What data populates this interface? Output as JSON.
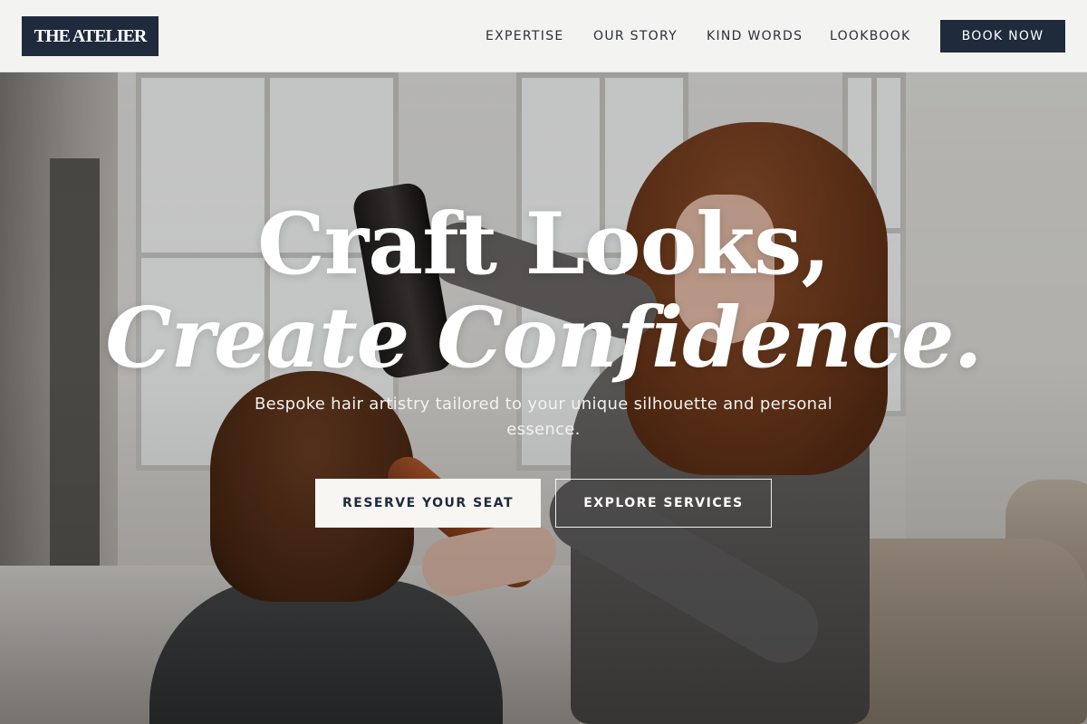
{
  "brand": {
    "logo_text": "THE ATELIER"
  },
  "nav": {
    "items": [
      {
        "label": "EXPERTISE"
      },
      {
        "label": "OUR STORY"
      },
      {
        "label": "KIND WORDS"
      },
      {
        "label": "LOOKBOOK"
      }
    ],
    "cta_label": "BOOK NOW"
  },
  "hero": {
    "headline_line1": "Craft Looks,",
    "headline_line2": "Create Confidence.",
    "subtitle": "Bespoke hair artistry tailored to your unique silhouette and personal essence.",
    "primary_button": "RESERVE YOUR SEAT",
    "secondary_button": "EXPLORE SERVICES"
  },
  "colors": {
    "brand_navy": "#1f2a3c",
    "header_bg": "#f6f6f4",
    "hero_text": "#ffffff",
    "primary_button_bg": "#f8f6f2"
  }
}
